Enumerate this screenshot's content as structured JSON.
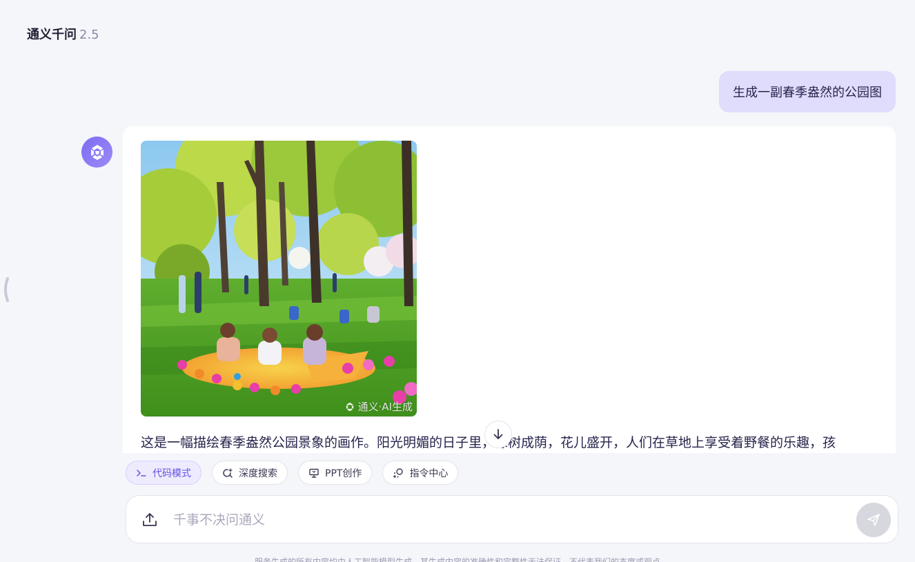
{
  "header": {
    "title": "通义千问",
    "version": "2.5"
  },
  "conversation": {
    "user_message": "生成一副春季盎然的公园图",
    "assistant": {
      "image_watermark": "通义·AI生成",
      "text": "这是一幅描绘春季盎然公园景象的画作。阳光明媚的日子里，绿树成荫，花儿盛开，人们在草地上享受着野餐的乐趣，孩"
    }
  },
  "quick_actions": [
    {
      "label": "代码模式",
      "icon": "terminal-icon",
      "active": true
    },
    {
      "label": "深度搜索",
      "icon": "deep-search-icon",
      "active": false
    },
    {
      "label": "PPT创作",
      "icon": "presentation-icon",
      "active": false
    },
    {
      "label": "指令中心",
      "icon": "command-center-icon",
      "active": false
    }
  ],
  "input": {
    "placeholder": "千事不决问通义",
    "value": ""
  },
  "footer": {
    "disclaimer": "服务生成的所有内容均由人工智能模型生成，其生成内容的准确性和完整性无法保证，不代表我们的态度或观点"
  },
  "colors": {
    "accent": "#6152e0",
    "user_bubble": "#e0dcfc",
    "avatar": "#7c6cf4",
    "send_disabled": "#d7d7df"
  }
}
